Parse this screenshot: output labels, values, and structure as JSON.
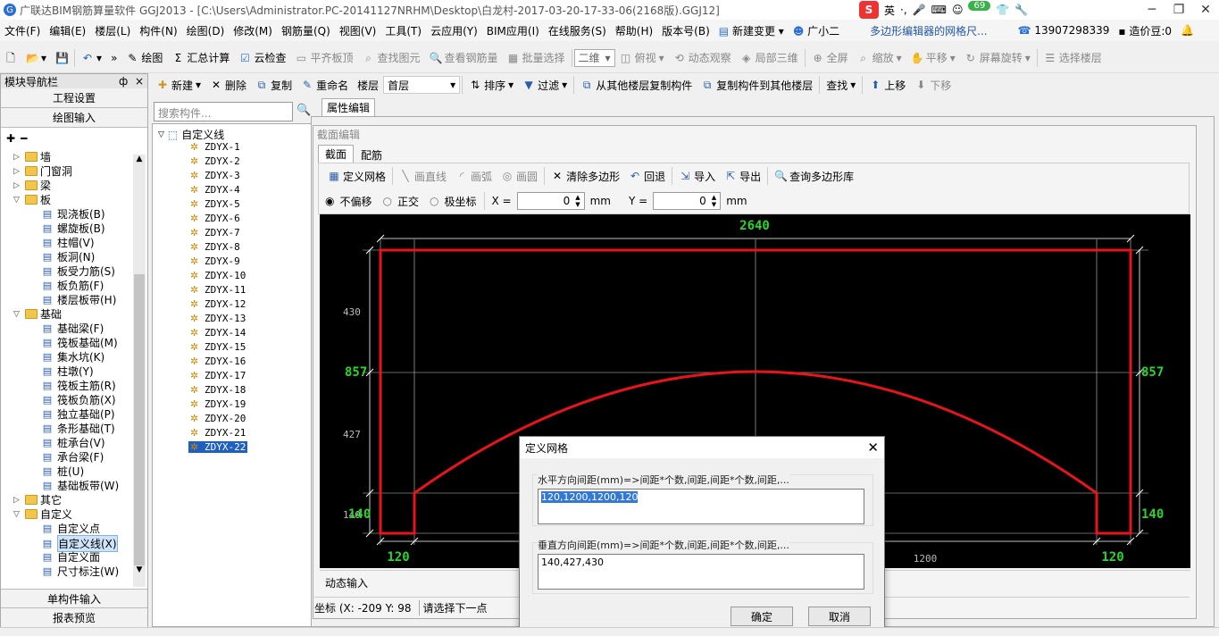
{
  "title_bar": {
    "app_title": "广联达BIM钢筋算量软件 GGJ2013 - [C:\\Users\\Administrator.PC-20141127NRHM\\Desktop\\白龙村-2017-03-20-17-33-06(2168版).GGJ12]",
    "ime_lang": "英",
    "ime_badge": "69"
  },
  "menu": {
    "items": [
      "文件(F)",
      "编辑(E)",
      "楼层(L)",
      "构件(N)",
      "绘图(D)",
      "修改(M)",
      "钢筋量(Q)",
      "视图(V)",
      "工具(T)",
      "云应用(Y)",
      "BIM应用(I)",
      "在线服务(S)",
      "帮助(H)",
      "版本号(B)",
      "新建变更",
      "广小二"
    ],
    "notice": "多边形编辑器的网格尺...",
    "phone": "13907298339",
    "price_bean": "造价豆:0"
  },
  "toolbar": {
    "draw": "绘图",
    "sum": "汇总计算",
    "cloud_check": "云检查",
    "align_slab": "平齐板顶",
    "find_elem": "查找图元",
    "view_rebar": "查看钢筋量",
    "batch_select": "批量选择",
    "view_mode": "二维",
    "top_view": "俯视",
    "dyn_view": "动态观察",
    "local_3d": "局部三维",
    "full_screen": "全屏",
    "zoom": "缩放",
    "pan": "平移",
    "rotate": "屏幕旋转",
    "select_floor": "选择楼层"
  },
  "comp_toolbar": {
    "new": "新建",
    "delete": "删除",
    "copy": "复制",
    "rename": "重命名",
    "floor_label": "楼层",
    "floor_value": "首层",
    "sort": "排序",
    "filter": "过滤",
    "copy_from": "从其他楼层复制构件",
    "copy_to": "复制构件到其他楼层",
    "find": "查找",
    "up": "上移",
    "down": "下移"
  },
  "nav": {
    "header": "模块导航栏",
    "pin": "ф",
    "close": "×",
    "proj_settings": "工程设置",
    "drawing_input": "绘图输入",
    "single_input": "单构件输入",
    "report_preview": "报表预览",
    "tree": [
      {
        "t": "folder",
        "label": "墙",
        "lvl": 0,
        "open": false
      },
      {
        "t": "folder",
        "label": "门窗洞",
        "lvl": 0,
        "open": false
      },
      {
        "t": "folder",
        "label": "梁",
        "lvl": 0,
        "open": false
      },
      {
        "t": "folder",
        "label": "板",
        "lvl": 0,
        "open": true
      },
      {
        "t": "leaf",
        "label": "现浇板(B)",
        "lvl": 1
      },
      {
        "t": "leaf",
        "label": "螺旋板(B)",
        "lvl": 1
      },
      {
        "t": "leaf",
        "label": "柱帽(V)",
        "lvl": 1
      },
      {
        "t": "leaf",
        "label": "板洞(N)",
        "lvl": 1
      },
      {
        "t": "leaf",
        "label": "板受力筋(S)",
        "lvl": 1
      },
      {
        "t": "leaf",
        "label": "板负筋(F)",
        "lvl": 1
      },
      {
        "t": "leaf",
        "label": "楼层板带(H)",
        "lvl": 1
      },
      {
        "t": "folder",
        "label": "基础",
        "lvl": 0,
        "open": true
      },
      {
        "t": "leaf",
        "label": "基础梁(F)",
        "lvl": 1
      },
      {
        "t": "leaf",
        "label": "筏板基础(M)",
        "lvl": 1
      },
      {
        "t": "leaf",
        "label": "集水坑(K)",
        "lvl": 1
      },
      {
        "t": "leaf",
        "label": "柱墩(Y)",
        "lvl": 1
      },
      {
        "t": "leaf",
        "label": "筏板主筋(R)",
        "lvl": 1
      },
      {
        "t": "leaf",
        "label": "筏板负筋(X)",
        "lvl": 1
      },
      {
        "t": "leaf",
        "label": "独立基础(P)",
        "lvl": 1
      },
      {
        "t": "leaf",
        "label": "条形基础(T)",
        "lvl": 1
      },
      {
        "t": "leaf",
        "label": "桩承台(V)",
        "lvl": 1
      },
      {
        "t": "leaf",
        "label": "承台梁(F)",
        "lvl": 1
      },
      {
        "t": "leaf",
        "label": "桩(U)",
        "lvl": 1
      },
      {
        "t": "leaf",
        "label": "基础板带(W)",
        "lvl": 1
      },
      {
        "t": "folder",
        "label": "其它",
        "lvl": 0,
        "open": false
      },
      {
        "t": "folder",
        "label": "自定义",
        "lvl": 0,
        "open": true
      },
      {
        "t": "leaf",
        "label": "自定义点",
        "lvl": 1
      },
      {
        "t": "leaf",
        "label": "自定义线(X)",
        "lvl": 1,
        "sel": true
      },
      {
        "t": "leaf",
        "label": "自定义面",
        "lvl": 1
      },
      {
        "t": "leaf",
        "label": "尺寸标注(W)",
        "lvl": 1
      }
    ]
  },
  "components": {
    "search_placeholder": "搜索构件...",
    "root": "自定义线",
    "items": [
      "ZDYX-1",
      "ZDYX-2",
      "ZDYX-3",
      "ZDYX-4",
      "ZDYX-5",
      "ZDYX-6",
      "ZDYX-7",
      "ZDYX-8",
      "ZDYX-9",
      "ZDYX-10",
      "ZDYX-11",
      "ZDYX-12",
      "ZDYX-13",
      "ZDYX-14",
      "ZDYX-15",
      "ZDYX-16",
      "ZDYX-17",
      "ZDYX-18",
      "ZDYX-19",
      "ZDYX-20",
      "ZDYX-21",
      "ZDYX-22"
    ],
    "selected": "ZDYX-22"
  },
  "property": {
    "tab": "属性编辑",
    "editor_title": "截面编辑",
    "tab_section": "截面",
    "tab_rebar": "配筋",
    "tools": {
      "define_grid": "定义网格",
      "draw_line": "画直线",
      "draw_arc": "画弧",
      "draw_circle": "画圆",
      "clear_poly": "清除多边形",
      "undo": "回退",
      "import": "导入",
      "export": "导出",
      "query_lib": "查询多边形库"
    },
    "offset": {
      "no_offset": "不偏移",
      "ortho": "正交",
      "polar": "极坐标",
      "x_label": "X =",
      "x_val": "0",
      "y_label": "Y =",
      "y_val": "0",
      "unit": "mm"
    },
    "dyn_input": "动态输入",
    "coord": "坐标 (X: -209 Y: 98",
    "hint": "请选择下一点"
  },
  "drawing": {
    "top_dim": "2640",
    "left_labels": [
      "430",
      "857",
      "427",
      "140",
      "140"
    ],
    "right_labels": [
      "857",
      "140"
    ],
    "bottom_labels": [
      "120",
      "1200",
      "120"
    ],
    "line_color": "#e8141c",
    "dim_color": "#2bd62b",
    "grid_color": "#cccccc"
  },
  "dialog": {
    "title": "定义网格",
    "h_label": "水平方向间距(mm)=>间距*个数,间距,间距*个数,间距,...",
    "h_value": "120,1200,1200,120",
    "v_label": "垂直方向间距(mm)=>间距*个数,间距,间距*个数,间距,...",
    "v_value": "140,427,430",
    "ok": "确定",
    "cancel": "取消"
  }
}
